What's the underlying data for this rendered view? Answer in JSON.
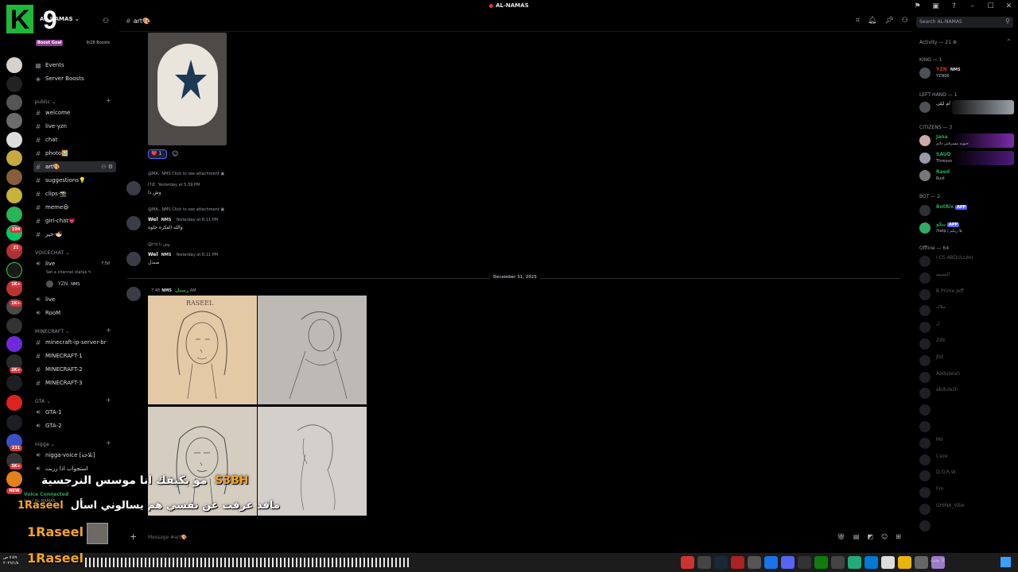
{
  "window": {
    "title": "AL-NAMAS",
    "controls": [
      "flag-icon",
      "inbox-icon",
      "help-icon",
      "minimize",
      "maximize",
      "close"
    ]
  },
  "overlay_logo": {
    "letter": "K",
    "number": "9"
  },
  "server": {
    "name": "AL-NAMAS",
    "boost_goal_label": "Boost Goal",
    "boost_count": "9/28 Boosts"
  },
  "sidebar": {
    "top_items": [
      {
        "icon": "calendar-icon",
        "label": "Events"
      },
      {
        "icon": "boost-icon",
        "label": "Server Boosts"
      }
    ],
    "categories": [
      {
        "name": "public",
        "channels": [
          "welcome",
          "live-yzn",
          "chat",
          "photo🖼️",
          "art🎨",
          "suggestions💡",
          "clips-📸",
          "meme😃",
          "girl-chat💗",
          "خير-🍜"
        ]
      },
      {
        "name": "VOICECHAT",
        "channels": [
          "live",
          "live",
          "RooM"
        ]
      },
      {
        "name": "MINECRAFT",
        "channels": [
          "minecraft-ip-server-br",
          "MINECRAFT-1",
          "MINECRAFT-2",
          "MINECRAFT-3"
        ]
      },
      {
        "name": "GTA",
        "channels": [
          "GTA-1",
          "GTA-2"
        ]
      },
      {
        "name": "nigga",
        "channels": [
          "nigga-voice [ثلاجة]",
          "استجواب اذا زربت"
        ]
      }
    ],
    "live_status": "Set a channel status",
    "live_time": "7:50",
    "voice_user": "YZN",
    "voice_user_tag": "NMS",
    "voice_connected": "Voice Connected",
    "voice_sub": "live / AL-NAMAS"
  },
  "header": {
    "channel": "art🎨"
  },
  "search": {
    "placeholder": "Search AL-NAMAS"
  },
  "messages": {
    "reaction": {
      "emoji": "❤️",
      "count": "1"
    },
    "items": [
      {
        "reply": "@MA.. NMS  Click to see attachment",
        "user": "r!d",
        "time": "Yesterday at 5:39 PM",
        "text": "وش ذا"
      },
      {
        "reply": "@MA.. NMS  Click to see attachment",
        "user": "Wel",
        "tag": "NMS",
        "time": "Yesterday at 6:11 PM",
        "text": "والله الفكره حلوه"
      },
      {
        "reply": "@r!d  وش ذا",
        "user": "Wel",
        "tag": "NMS",
        "time": "Yesterday at 6:11 PM",
        "text": "صندل"
      },
      {
        "user": "رسيل",
        "tag": "NMS",
        "time": "7:48 AM"
      }
    ],
    "date_divider": "December 31, 2025",
    "sketch_label": "RASEEL"
  },
  "composer": {
    "placeholder": "Message #art🎨"
  },
  "members": {
    "activity": "Activity — 21",
    "groups": [
      {
        "role": "KING — 1",
        "members": [
          {
            "name": "YZN",
            "sub": "YZN06",
            "tag": "NMS"
          }
        ]
      },
      {
        "role": "LEFT HAND — 1",
        "members": [
          {
            "name": "ام ليلى",
            "sub": ""
          }
        ]
      },
      {
        "role": "CITIZENS — 3",
        "members": [
          {
            "name": "Jana",
            "sub": "حنونه مسرقتي دائم"
          },
          {
            "name": "SAUD",
            "sub": "Threoso"
          },
          {
            "name": "Raed",
            "sub": "Rust"
          }
        ]
      },
      {
        "role": "BOT — 2",
        "members": [
          {
            "name": "BotRix",
            "sub": "",
            "badge": "APP"
          },
          {
            "name": "نيكو",
            "sub": "/help | يلا ربكم",
            "badge": "APP"
          }
        ]
      }
    ],
    "offline_label": "Offline — 64",
    "offline": [
      "I CS ABDULLAH",
      "البضيبه",
      "B Prime Jeff",
      "ملاك",
      "ل",
      "Zillc",
      "Jlld",
      "Abdulelah",
      "abdulezh",
      "",
      "",
      "Mir",
      "Ceze",
      "D.O.R.W",
      "Fm",
      "GHINA_Vibe",
      ""
    ]
  },
  "subtitles": {
    "line1_user": "S3BH",
    "line1_text": "مو بكيفك انا موسس النرجسية",
    "line2_user": "1Raseel",
    "line2_text": "مافد عرفت عن نفسي هم يسالوني اسأل",
    "line3_user": "1Raseel",
    "line4_user": "1Raseel"
  },
  "taskbar": {
    "clock": "٧:٥٩ ص",
    "date": "٢٠٢٦/١/٨",
    "search": "بحث"
  },
  "colors": {
    "accent": "#5865f2",
    "online": "#23a55a",
    "boost": "#8a3f8f",
    "danger": "#da373c",
    "subtitle_name": "#f5a623"
  }
}
